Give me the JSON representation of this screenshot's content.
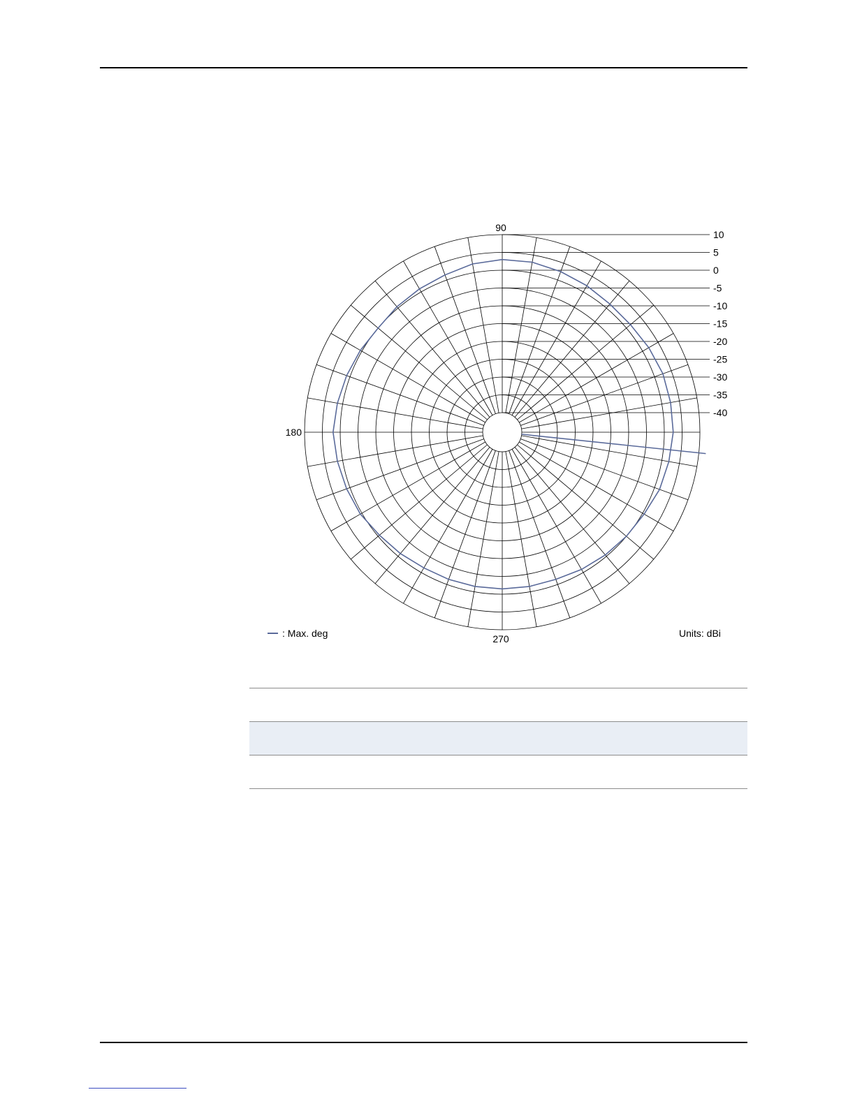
{
  "chart_data": {
    "type": "polar",
    "angle_labels": [
      {
        "angle": 90,
        "label": "90"
      },
      {
        "angle": 180,
        "label": "180"
      },
      {
        "angle": 270,
        "label": "270"
      }
    ],
    "radial_ticks": [
      10,
      5,
      0,
      -5,
      -10,
      -15,
      -20,
      -25,
      -30,
      -35,
      -40
    ],
    "rlim": [
      -40,
      10
    ],
    "angular_grid_step_deg": 10,
    "legend_label": ": Max. deg",
    "units_label": "Units: dBi",
    "line_color": "#5a6a9a",
    "series": [
      {
        "name": ": Max. deg",
        "theta": [
          0,
          10,
          20,
          30,
          40,
          50,
          60,
          70,
          80,
          90,
          100,
          110,
          120,
          130,
          140,
          150,
          160,
          170,
          180,
          190,
          200,
          210,
          220,
          230,
          240,
          250,
          260,
          270,
          280,
          290,
          300,
          310,
          320,
          330,
          340,
          350,
          360
        ],
        "r": [
          2.5,
          2.5,
          2.5,
          2,
          1.5,
          1.5,
          2,
          2.5,
          3,
          3,
          2.5,
          1.5,
          1,
          0.5,
          0,
          0.5,
          1,
          1.5,
          2,
          1.5,
          1,
          0.5,
          -0.5,
          -1,
          -1.5,
          -1.5,
          -1.5,
          -1.5,
          -1.5,
          -1.5,
          -1,
          -0.5,
          0,
          0.5,
          1.5,
          2,
          2.5
        ]
      }
    ]
  }
}
